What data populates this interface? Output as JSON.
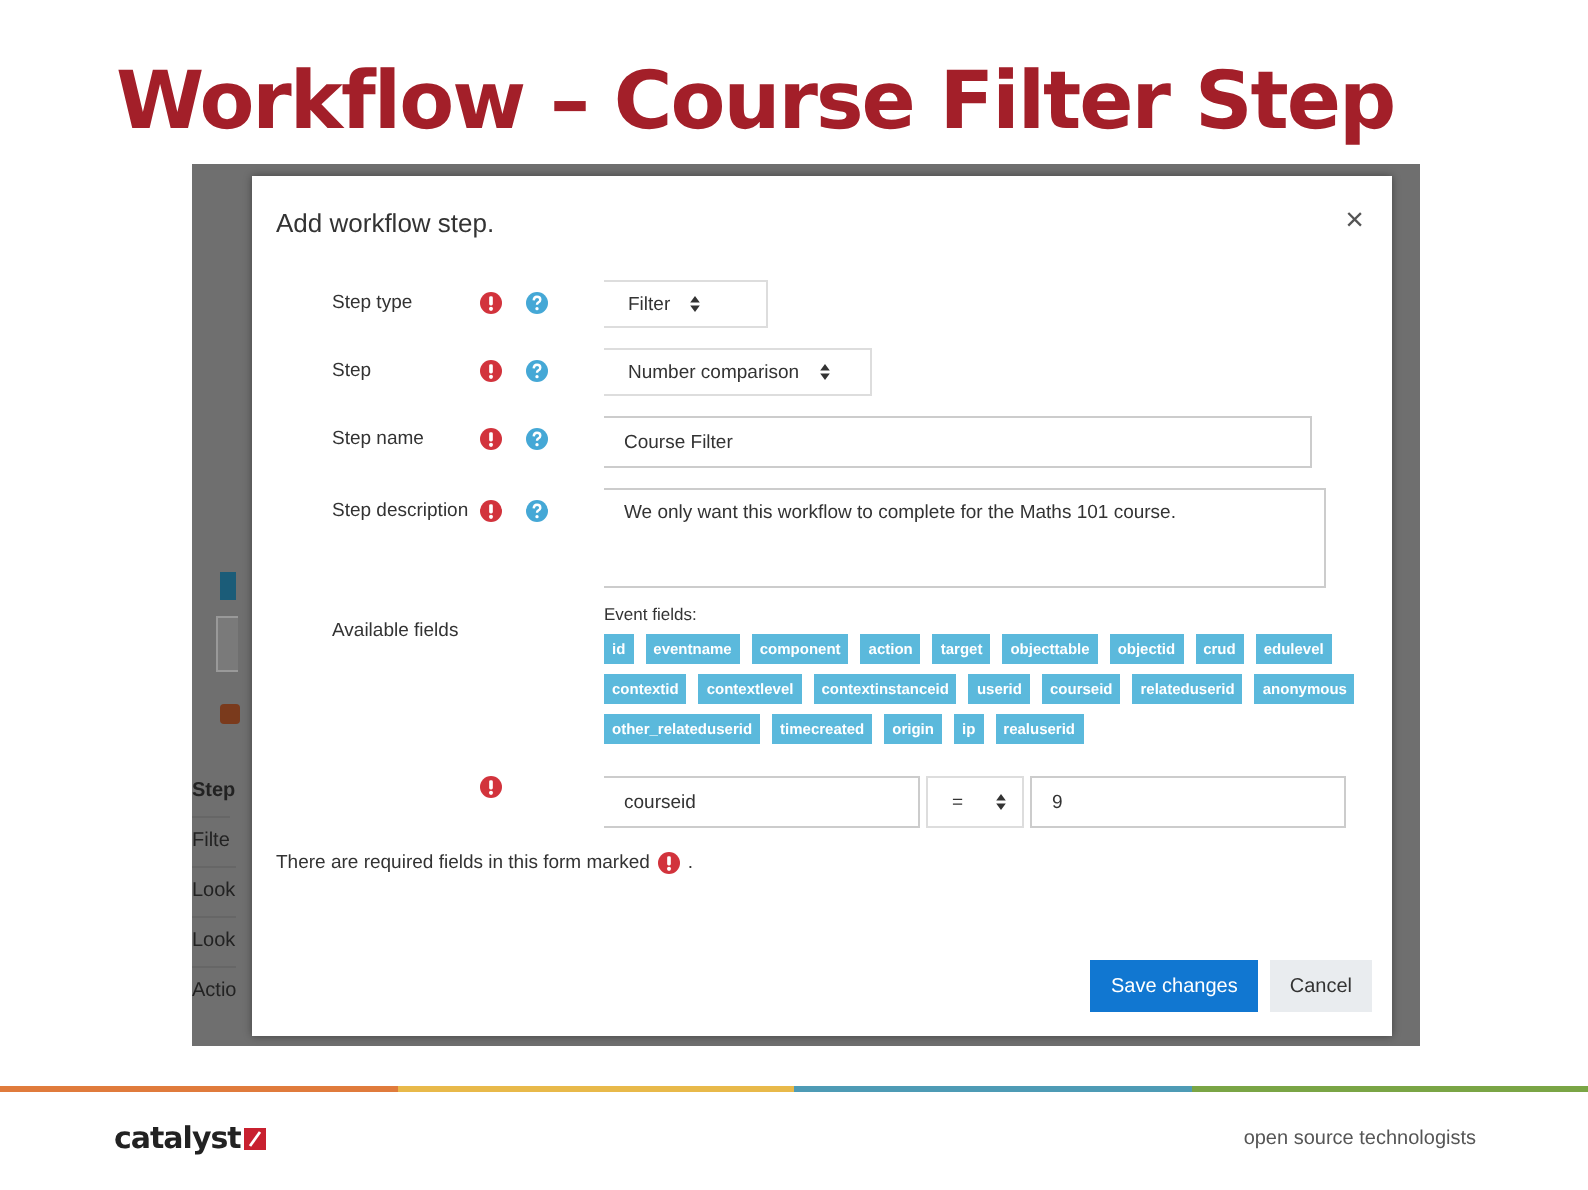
{
  "slide_title": "Workflow – Course Filter Step",
  "background_page": {
    "labels": [
      "Step",
      "Filte",
      "Look",
      "Look",
      "Actio"
    ],
    "checkbox_checked": true
  },
  "dialog": {
    "title": "Add workflow step.",
    "close": "×",
    "rows": [
      {
        "kind": "select",
        "label": "Step type",
        "required": true,
        "help": true,
        "value": "Filter"
      },
      {
        "kind": "select",
        "label": "Step",
        "required": true,
        "help": true,
        "value": "Number comparison"
      },
      {
        "kind": "input",
        "label": "Step name",
        "required": true,
        "help": true,
        "value": "Course Filter"
      },
      {
        "kind": "textarea",
        "label": "Step description",
        "required": true,
        "help": true,
        "value": "We only want this workflow to complete for the Maths 101 course."
      },
      {
        "kind": "tags",
        "label": "Available fields",
        "required": false,
        "help": false,
        "heading": "Event fields:",
        "tag_rows": [
          [
            "id",
            "eventname",
            "component",
            "action",
            "target",
            "objecttable",
            "objectid",
            "crud",
            "edulevel"
          ],
          [
            "contextid",
            "contextlevel",
            "contextinstanceid",
            "userid",
            "courseid",
            "relateduserid",
            "anonymous"
          ],
          [
            "other_relateduserid",
            "timecreated",
            "origin",
            "ip",
            "realuserid"
          ]
        ]
      },
      {
        "kind": "condition",
        "label": "",
        "required": true,
        "help": false,
        "field": "courseid",
        "operator": "=",
        "value": "9"
      }
    ],
    "note": "There are required fields in this form marked",
    "note_end": ".",
    "buttons": [
      {
        "label": "Save changes",
        "primary": true
      },
      {
        "label": "Cancel",
        "primary": false
      }
    ]
  },
  "footer": {
    "logo": "catalyst",
    "tagline": "open source technologists"
  }
}
